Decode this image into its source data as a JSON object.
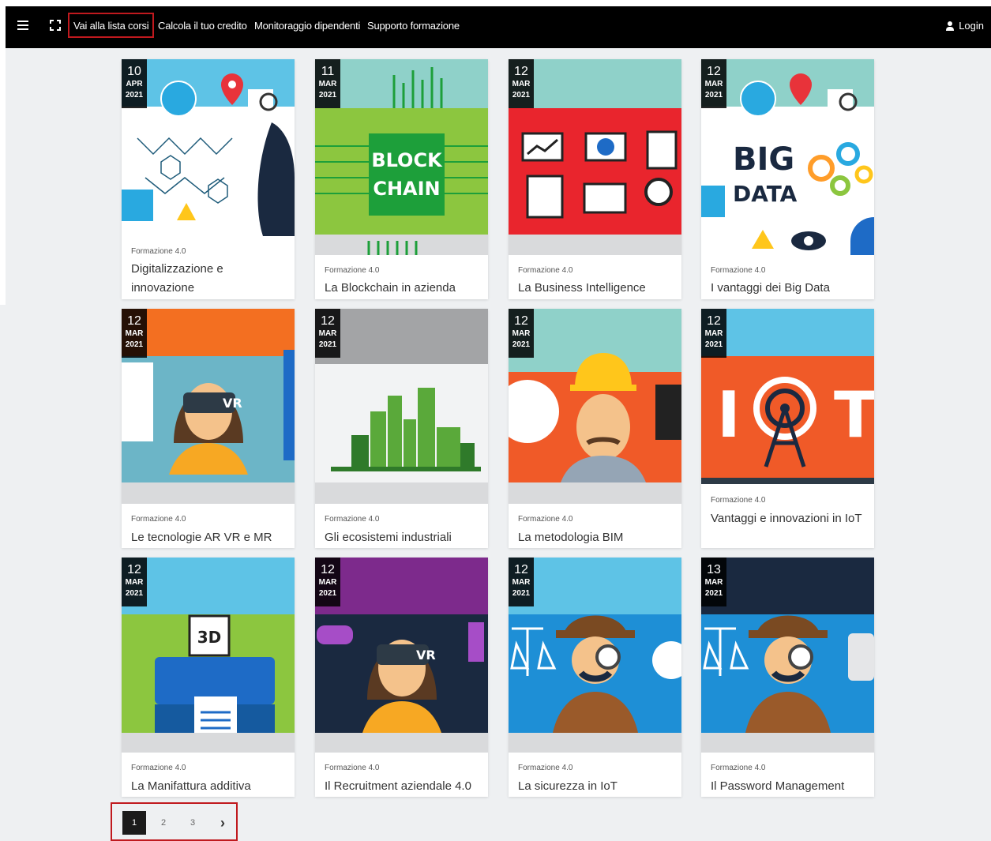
{
  "nav": {
    "links": [
      "Vai alla lista corsi",
      "Calcola il tuo credito",
      "Monitoraggio dipendenti",
      "Supporto formazione"
    ],
    "login": "Login"
  },
  "cards": [
    {
      "day": "10",
      "month": "APR",
      "year": "2021",
      "category": "Formazione 4.0",
      "title": "Digitalizzazione e innovazione"
    },
    {
      "day": "11",
      "month": "MAR",
      "year": "2021",
      "category": "Formazione 4.0",
      "title": "La Blockchain in azienda"
    },
    {
      "day": "12",
      "month": "MAR",
      "year": "2021",
      "category": "Formazione 4.0",
      "title": "La Business Intelligence"
    },
    {
      "day": "12",
      "month": "MAR",
      "year": "2021",
      "category": "Formazione 4.0",
      "title": "I vantaggi dei Big Data"
    },
    {
      "day": "12",
      "month": "MAR",
      "year": "2021",
      "category": "Formazione 4.0",
      "title": "Le tecnologie AR VR e MR"
    },
    {
      "day": "12",
      "month": "MAR",
      "year": "2021",
      "category": "Formazione 4.0",
      "title": "Gli ecosistemi industriali"
    },
    {
      "day": "12",
      "month": "MAR",
      "year": "2021",
      "category": "Formazione 4.0",
      "title": "La metodologia BIM"
    },
    {
      "day": "12",
      "month": "MAR",
      "year": "2021",
      "category": "Formazione 4.0",
      "title": "Vantaggi e innovazioni in IoT"
    },
    {
      "day": "12",
      "month": "MAR",
      "year": "2021",
      "category": "Formazione 4.0",
      "title": "La Manifattura additiva"
    },
    {
      "day": "12",
      "month": "MAR",
      "year": "2021",
      "category": "Formazione 4.0",
      "title": "Il Recruitment aziendale 4.0"
    },
    {
      "day": "12",
      "month": "MAR",
      "year": "2021",
      "category": "Formazione 4.0",
      "title": "La sicurezza in IoT"
    },
    {
      "day": "13",
      "month": "MAR",
      "year": "2021",
      "category": "Formazione 4.0",
      "title": "Il Password Management"
    }
  ],
  "image_text": {
    "blockchain": [
      "BLOCK",
      "CHAIN"
    ],
    "bigdata": [
      "BIG",
      "DATA"
    ],
    "vr": "VR",
    "print3d": "3D",
    "iot": [
      "I",
      "T"
    ]
  },
  "pagination": {
    "pages": [
      "1",
      "2",
      "3"
    ],
    "active": "1",
    "next": "›"
  },
  "colors": {
    "topbar": "#000000",
    "highlight": "#c0191e",
    "page_bg": "#eef0f2"
  }
}
